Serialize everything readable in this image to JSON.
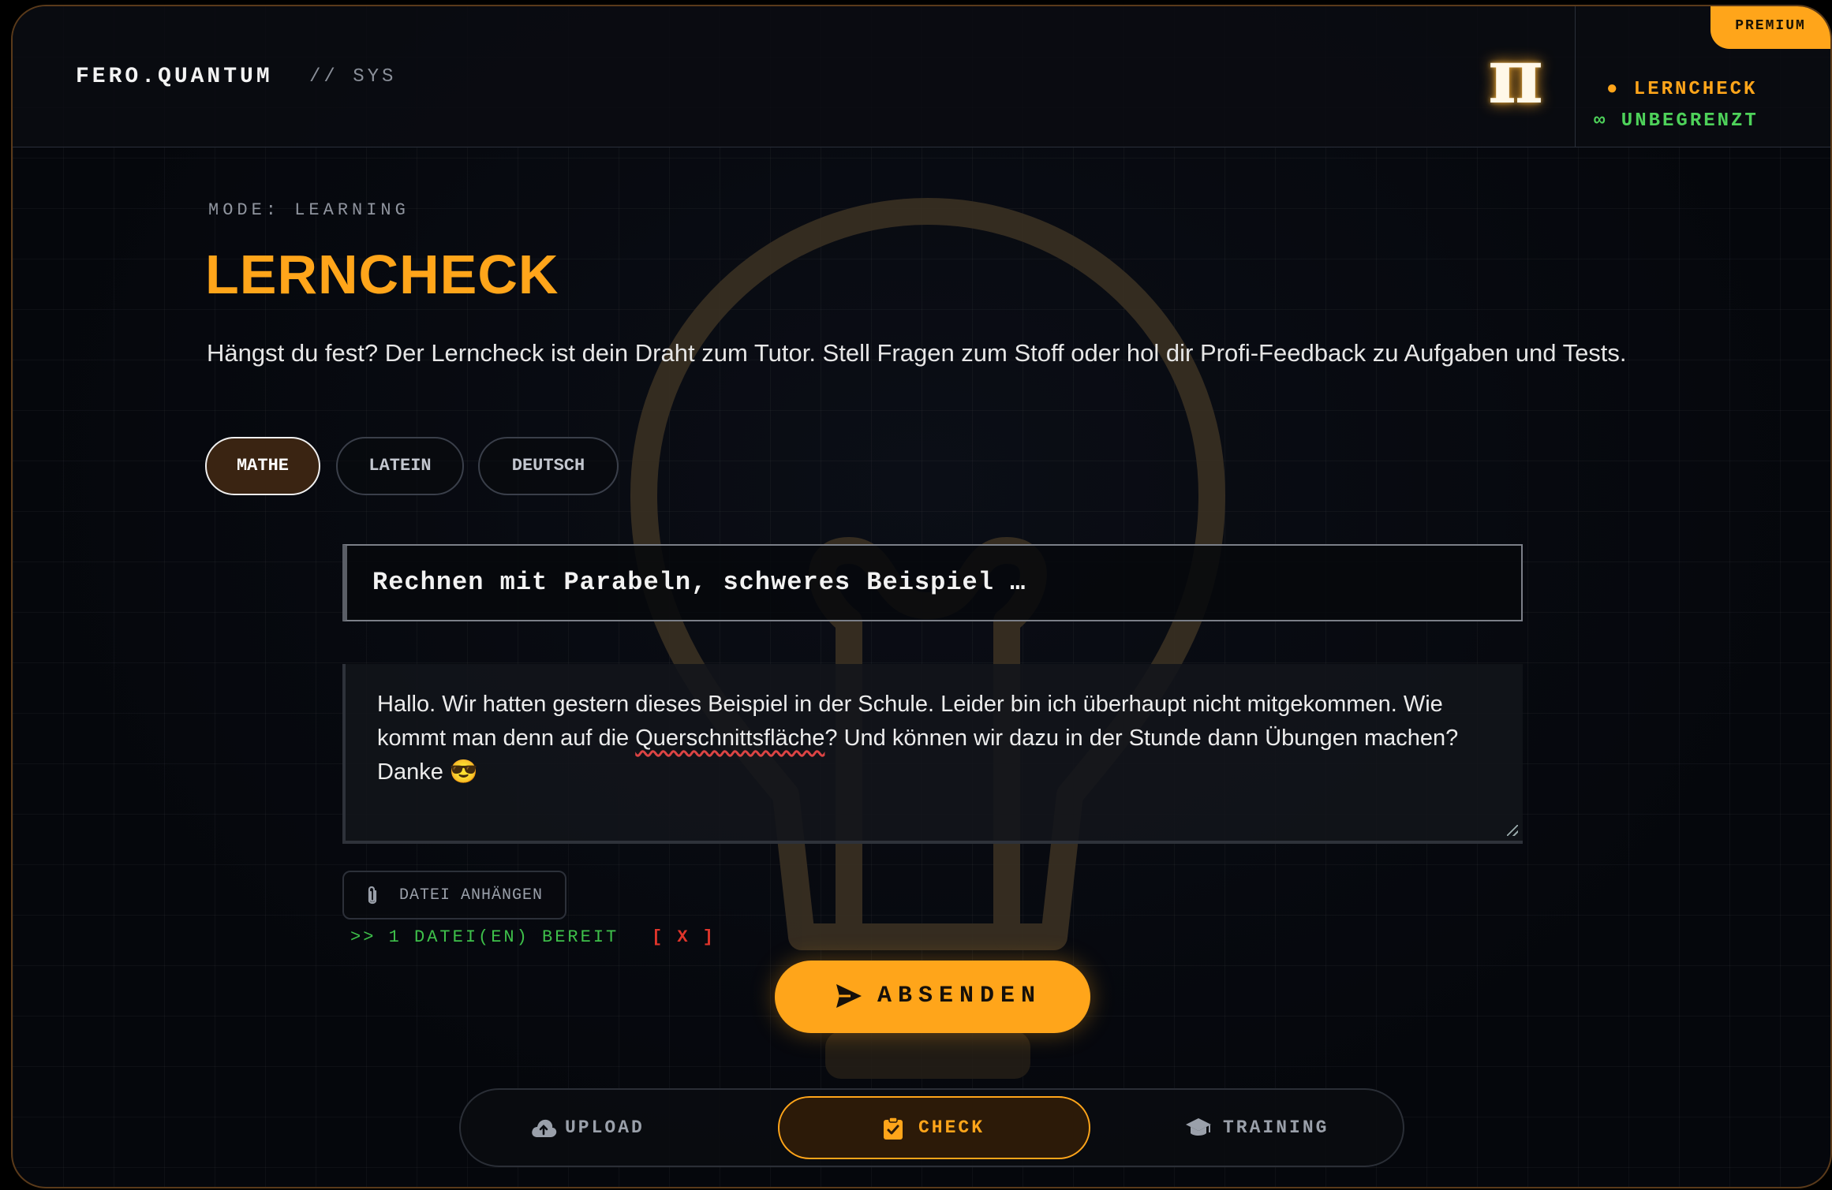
{
  "header": {
    "brand": "FERO.QUANTUM",
    "brand_suffix": "// SYS",
    "logo_glyph": "π",
    "premium_badge": "PREMIUM",
    "status_mode": "● LERNCHECK",
    "status_quota": "∞ UNBEGRENZT"
  },
  "main": {
    "mode_label": "MODE: LEARNING",
    "title": "LERNCHECK",
    "description": "Hängst du fest? Der Lerncheck ist dein Draht zum Tutor. Stell Fragen zum Stoff oder hol dir Profi-Feedback zu Aufgaben und Tests.",
    "subjects": [
      {
        "label": "MATHE",
        "active": true
      },
      {
        "label": "LATEIN",
        "active": false
      },
      {
        "label": "DEUTSCH",
        "active": false
      }
    ],
    "topic_value": "Rechnen mit Parabeln, schweres Beispiel …",
    "message_part1": "Hallo. Wir hatten gestern dieses Beispiel in der Schule. Leider bin ich überhaupt nicht mitgekommen. Wie kommt man denn auf die ",
    "message_misspelled": "Querschnittsfläche",
    "message_part2": "? Und können wir dazu in der Stunde dann Übungen machen? Danke 😎",
    "attach_label": "DATEI ANHÄNGEN",
    "files_ready": ">> 1 DATEI(EN) BEREIT",
    "files_clear": "[ X ]",
    "submit_label": "ABSENDEN"
  },
  "bottom_nav": {
    "items": [
      {
        "label": "UPLOAD",
        "icon": "cloud-upload-icon",
        "active": false
      },
      {
        "label": "CHECK",
        "icon": "clipboard-check-icon",
        "active": true
      },
      {
        "label": "TRAINING",
        "icon": "graduation-cap-icon",
        "active": false
      }
    ]
  },
  "colors": {
    "accent": "#ffa51a",
    "success": "#3ec04a",
    "danger": "#e0352b",
    "background": "#05070c"
  }
}
